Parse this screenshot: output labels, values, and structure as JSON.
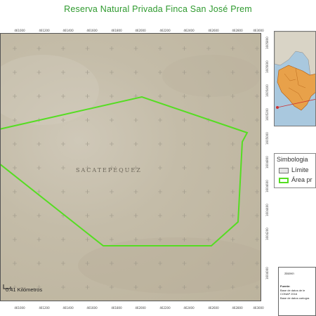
{
  "title": "Reserva Natural Privada Finca San José Prem",
  "top_ticks": [
    "461000",
    "461200",
    "461400",
    "461600",
    "461800",
    "462000",
    "462200",
    "462400",
    "462600",
    "462800",
    "463000"
  ],
  "bottom_ticks": [
    "461000",
    "461200",
    "461400",
    "461600",
    "461800",
    "462000",
    "462200",
    "462400",
    "462600",
    "462800",
    "463000"
  ],
  "right_ticks": [
    "1605800",
    "1605600",
    "1605400",
    "1605200",
    "1605000",
    "1604800",
    "1604600",
    "1604400",
    "1604200",
    "1604000"
  ],
  "region_label": "SACATEPÉQUEZ",
  "scale": {
    "label": "0.41 Kilómetros"
  },
  "legend": {
    "title": "Simbologia",
    "items": [
      {
        "label": "Límite",
        "color": "#e6e6e6",
        "border": "#777777"
      },
      {
        "label": "Área pr",
        "color": "#ffffff",
        "border": "#55dd22"
      }
    ]
  },
  "info_box": {
    "heading": "Sistem",
    "source_label": "Fuente:",
    "source_lines": [
      "Base de datos de le",
      "CONAP 2016",
      "Base de datos cartogra"
    ]
  },
  "colors": {
    "title": "#2e9a2e",
    "polygon": "#55dd22",
    "basemap": "#c4bca8"
  }
}
